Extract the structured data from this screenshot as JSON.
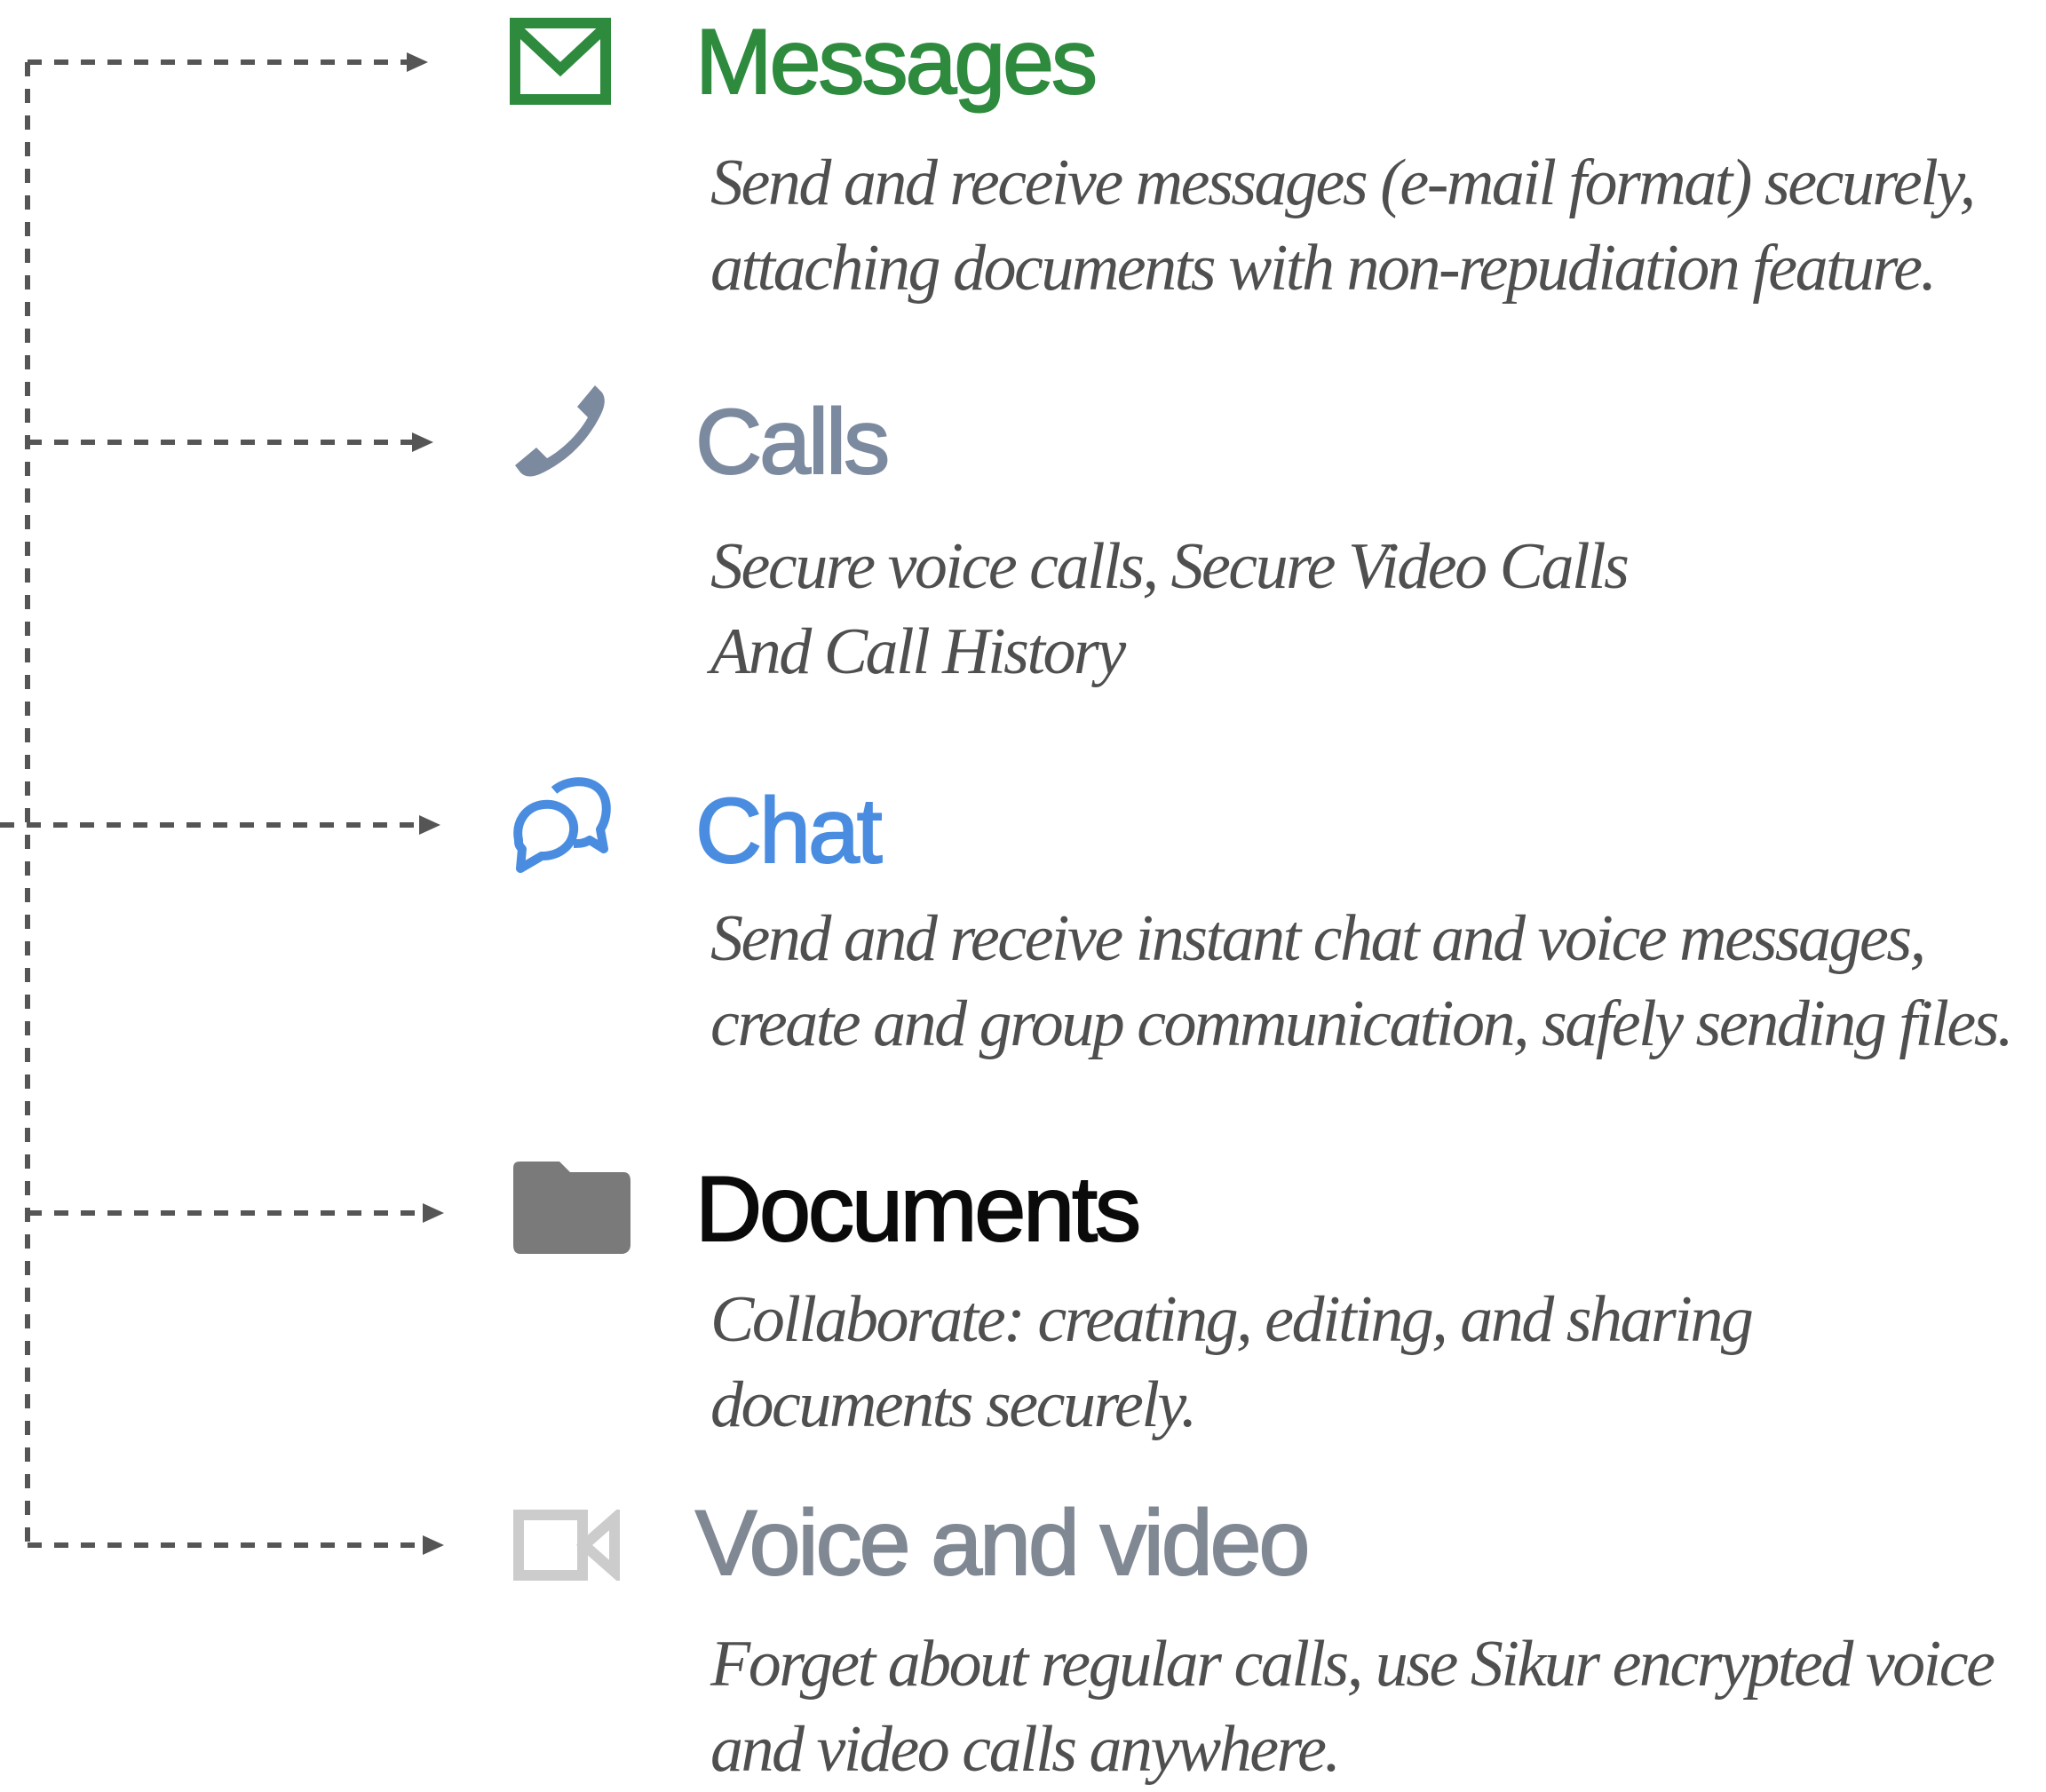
{
  "colors": {
    "connector": "#555555",
    "messages": "#2e8b3e",
    "calls": "#7c8aa0",
    "chat": "#4a8de0",
    "documents": "#0a0a0a",
    "documents_icon": "#7a7a7a",
    "voice_video": "#808893",
    "voice_video_icon": "#cccccc",
    "description": "#4f4f4f"
  },
  "features": [
    {
      "id": "messages",
      "icon": "envelope-icon",
      "title": "Messages",
      "description": [
        "Send and receive messages (e-mail format) securely,",
        "attaching documents with non-repudiation feature."
      ]
    },
    {
      "id": "calls",
      "icon": "phone-icon",
      "title": "Calls",
      "description": [
        "Secure voice calls, Secure Video Calls",
        "And Call History"
      ]
    },
    {
      "id": "chat",
      "icon": "chat-bubbles-icon",
      "title": "Chat",
      "description": [
        "Send and receive instant chat and voice messages,",
        "create and group communication, safely sending files."
      ]
    },
    {
      "id": "documents",
      "icon": "folder-icon",
      "title": "Documents",
      "description": [
        "Collaborate: creating, editing, and sharing",
        "documents securely."
      ]
    },
    {
      "id": "voice_video",
      "icon": "video-camera-icon",
      "title": "Voice and video",
      "description": [
        "Forget about regular calls, use Sikur encrypted voice",
        "and video calls anywhere."
      ]
    }
  ]
}
